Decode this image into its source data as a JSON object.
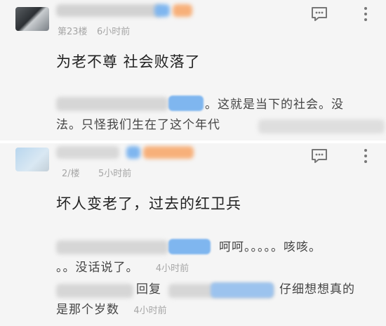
{
  "comments": [
    {
      "floor": "第23楼",
      "time": "6小时前",
      "content": "为老不尊 社会败落了",
      "reply": {
        "line1": "。这就是当下的社会。没",
        "line2": "法。只怪我们生在了这个年代"
      }
    },
    {
      "floor": "2/楼",
      "time": "5小时前",
      "content": "坏人变老了，过去的红卫兵",
      "replies": [
        {
          "line1": "呵呵。。。。。咳咳。",
          "line2": "。。没话说了。",
          "time": "4小时前"
        },
        {
          "line1a": "回复",
          "line1b": "仔细想想真的",
          "line2": "是那个岁数",
          "time": "4小时前"
        }
      ]
    }
  ],
  "icons": [
    "comment-icon",
    "more-vertical-icon"
  ],
  "colors": {
    "background": "#f5f5f5",
    "text": "#222222",
    "meta": "#a6a6a6",
    "blur_blue": "#7fb6ef",
    "blur_orange": "#f7b07a"
  }
}
